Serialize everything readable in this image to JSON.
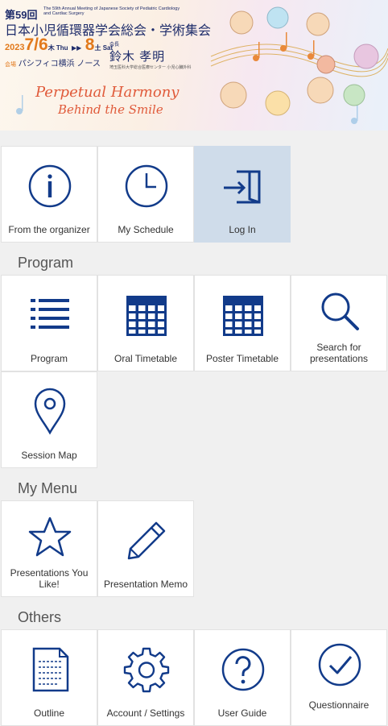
{
  "banner": {
    "edition": "第59回",
    "english": "The 59th Annual Meeting of Japanese Society of Pediatric Cardiology and Cardiac Surgery",
    "title_jp": "日本小児循環器学会総会・学術集会",
    "year": "2023",
    "d1": "7/6",
    "d1_day": "木 Thu",
    "d2": "8",
    "d2_day": "土 Sat",
    "venue_label": "会場",
    "venue": "パシフィコ横浜 ノース",
    "president_label": "会長",
    "president": "鈴木 孝明",
    "affiliation": "埼玉医科大学総合医療センター 小児心臓外科",
    "tagline1": "Perpetual Harmony",
    "tagline2": "Behind the Smile"
  },
  "tiles_top": [
    {
      "label": "From the organizer",
      "icon": "info-icon"
    },
    {
      "label": "My Schedule",
      "icon": "clock-icon"
    },
    {
      "label": "Log In",
      "icon": "login-icon"
    }
  ],
  "sections": {
    "program": "Program",
    "my_menu": "My Menu",
    "others": "Others"
  },
  "tiles_program": [
    {
      "label": "Program",
      "icon": "list-icon"
    },
    {
      "label": "Oral Timetable",
      "icon": "calendar-icon"
    },
    {
      "label": "Poster Timetable",
      "icon": "calendar-icon"
    },
    {
      "label": "Search for presentations",
      "icon": "search-icon"
    },
    {
      "label": "Session Map",
      "icon": "map-pin-icon"
    }
  ],
  "tiles_mymenu": [
    {
      "label": "Presentations You Like!",
      "icon": "star-icon"
    },
    {
      "label": "Presentation Memo",
      "icon": "pencil-icon"
    }
  ],
  "tiles_others": [
    {
      "label": "Outline",
      "icon": "document-icon"
    },
    {
      "label": "Account / Settings",
      "icon": "gear-icon"
    },
    {
      "label": "User Guide",
      "icon": "help-icon"
    },
    {
      "label": "Questionnaire",
      "icon": "check-icon"
    }
  ],
  "colors": {
    "icon_blue": "#123b8a",
    "active_tile": "#cfdcea"
  }
}
